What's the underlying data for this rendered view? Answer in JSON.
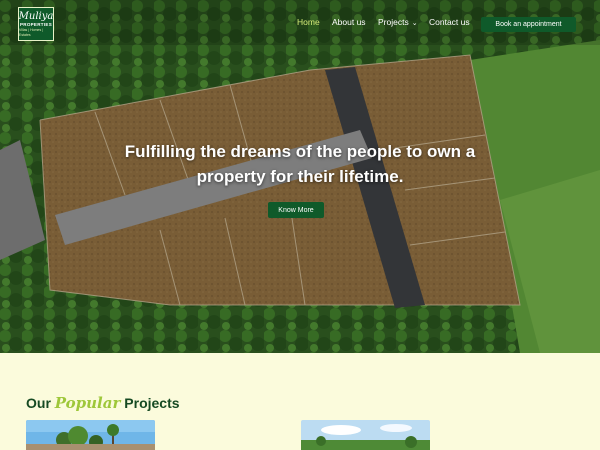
{
  "logo": {
    "line1": "Muliya",
    "line2": "PROPERTIES",
    "line3": "Villas | Homes | Estates"
  },
  "nav": {
    "items": [
      {
        "label": "Home",
        "active": true
      },
      {
        "label": "About us",
        "active": false
      },
      {
        "label": "Projects",
        "active": false,
        "has_dropdown": true
      },
      {
        "label": "Contact us",
        "active": false
      }
    ],
    "cta_label": "Book an appointment"
  },
  "hero": {
    "headline": "Fulfilling the dreams of the people to own a property for their lifetime.",
    "button_label": "Know More"
  },
  "projects_section": {
    "title_prefix": "Our",
    "title_accent": "Popular",
    "title_suffix": "Projects"
  },
  "colors": {
    "brand_green": "#0f5a2a",
    "nav_active": "#d8ef7a",
    "accent_lime": "#9ec73a",
    "section_bg": "#fbfbdc",
    "title_green": "#164a22"
  }
}
